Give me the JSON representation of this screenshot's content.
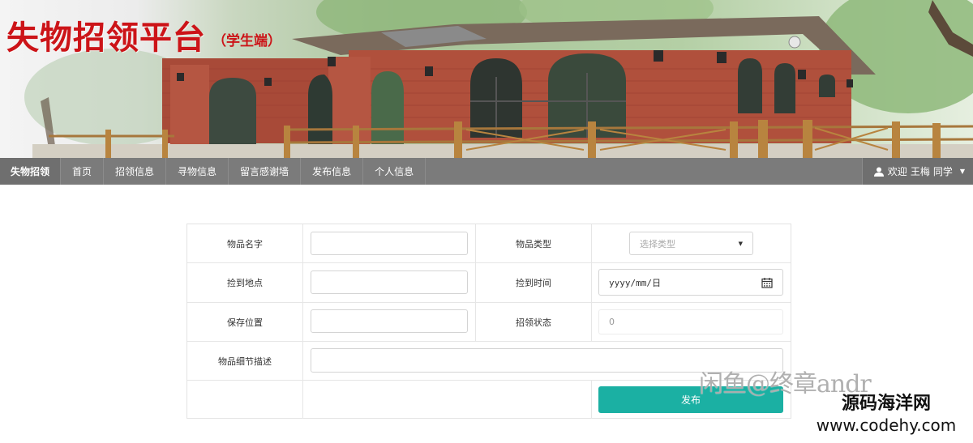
{
  "banner": {
    "title": "失物招领平台",
    "subtitle": "（学生端）"
  },
  "navbar": {
    "brand": "失物招领",
    "items": [
      {
        "label": "首页"
      },
      {
        "label": "招领信息"
      },
      {
        "label": "寻物信息"
      },
      {
        "label": "留言感谢墙"
      },
      {
        "label": "发布信息"
      },
      {
        "label": "个人信息"
      }
    ],
    "user": {
      "welcome": "欢迎",
      "name": "王梅",
      "role": "同学",
      "icon": "user-icon"
    }
  },
  "form": {
    "item_name_label": "物品名字",
    "item_name_value": "",
    "item_type_label": "物品类型",
    "item_type_placeholder": "选择类型",
    "found_place_label": "捡到地点",
    "found_place_value": "",
    "found_time_label": "捡到时间",
    "found_time_placeholder": "yyyy/mm/日",
    "storage_label": "保存位置",
    "storage_value": "",
    "claim_status_label": "招领状态",
    "claim_status_value": "0",
    "detail_label": "物品细节描述",
    "detail_value": "",
    "submit_label": "发布"
  },
  "watermarks": {
    "xianyu": "闲鱼@终章andr",
    "site_name": "源码海洋网",
    "site_url": "www.codehy.com"
  },
  "colors": {
    "title_red": "#cc1418",
    "navbar_bg": "#7b7b7b",
    "submit_teal": "#1bb0a3"
  }
}
